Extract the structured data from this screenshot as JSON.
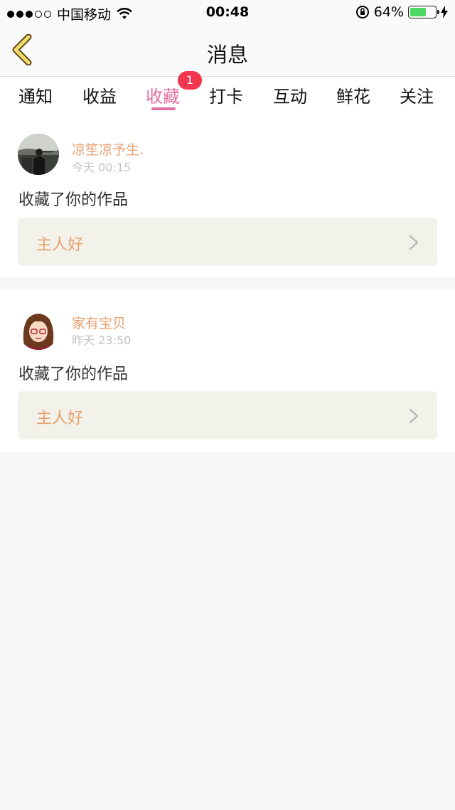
{
  "status_bar": {
    "carrier": "中国移动",
    "time": "00:48",
    "battery_percent": "64%",
    "battery_level": 0.64
  },
  "header": {
    "title": "消息"
  },
  "tabs": [
    {
      "label": "通知"
    },
    {
      "label": "收益"
    },
    {
      "label": "收藏",
      "active": true,
      "badge": "1"
    },
    {
      "label": "打卡"
    },
    {
      "label": "互动"
    },
    {
      "label": "鲜花"
    },
    {
      "label": "关注"
    }
  ],
  "messages": [
    {
      "username": "凉笙凉予生.",
      "time": "今天 00:15",
      "action": "收藏了你的作品",
      "work_title": "主人好"
    },
    {
      "username": "家有宝贝",
      "time": "昨天 23:50",
      "action": "收藏了你的作品",
      "work_title": "主人好"
    }
  ],
  "colors": {
    "accent": "#e46fa2",
    "username": "#e9a06e",
    "badge": "#f3364f",
    "background": "#f8f6f7"
  }
}
